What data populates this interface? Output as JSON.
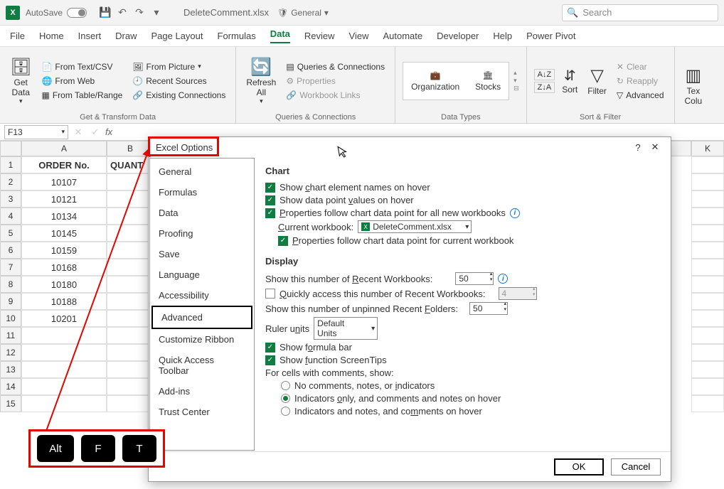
{
  "titlebar": {
    "autosave": "AutoSave",
    "filename": "DeleteComment.xlsx",
    "sensitivity": "General",
    "search_placeholder": "Search"
  },
  "menubar": {
    "items": [
      "File",
      "Home",
      "Insert",
      "Draw",
      "Page Layout",
      "Formulas",
      "Data",
      "Review",
      "View",
      "Automate",
      "Developer",
      "Help",
      "Power Pivot"
    ],
    "active": "Data"
  },
  "ribbon": {
    "getdata": {
      "big": "Get\nData",
      "items": [
        "From Text/CSV",
        "From Web",
        "From Table/Range",
        "From Picture",
        "Recent Sources",
        "Existing Connections"
      ],
      "label": "Get & Transform Data"
    },
    "refresh": {
      "big": "Refresh\nAll",
      "items": [
        "Queries & Connections",
        "Properties",
        "Workbook Links"
      ],
      "label": "Queries & Connections"
    },
    "datatypes": {
      "items": [
        "Organization",
        "Stocks"
      ],
      "label": "Data Types"
    },
    "sortfilter": {
      "sort": "Sort",
      "filter": "Filter",
      "clear": "Clear",
      "reapply": "Reapply",
      "advanced": "Advanced",
      "label": "Sort & Filter"
    },
    "text": {
      "big": "Tex\nColu"
    }
  },
  "formulabar": {
    "namebox": "F13"
  },
  "sheet": {
    "columns": [
      "A",
      "B"
    ],
    "far_col": "K",
    "headers": [
      "ORDER No.",
      "QUANT"
    ],
    "data": [
      "10107",
      "10121",
      "10134",
      "10145",
      "10159",
      "10168",
      "10180",
      "10188",
      "10201"
    ],
    "colA_width": 120,
    "colB_width": 66
  },
  "dialog": {
    "title": "Excel Options",
    "sidebar": [
      "General",
      "Formulas",
      "Data",
      "Proofing",
      "Save",
      "Language",
      "Accessibility",
      "Advanced",
      "Customize Ribbon",
      "Quick Access Toolbar",
      "Add-ins",
      "Trust Center"
    ],
    "selected": "Advanced",
    "chart": {
      "heading": "Chart",
      "o1": "Show chart element names on hover",
      "o2": "Show data point values on hover",
      "o3": "Properties follow chart data point for all new workbooks",
      "cwlabel": "Current workbook:",
      "cwvalue": "DeleteComment.xlsx",
      "o4": "Properties follow chart data point for current workbook"
    },
    "display": {
      "heading": "Display",
      "recent_label": "Show this number of Recent Workbooks:",
      "recent_value": "50",
      "quick": "Quickly access this number of Recent Workbooks:",
      "quick_value": "4",
      "folders_label": "Show this number of unpinned Recent Folders:",
      "folders_value": "50",
      "ruler_label": "Ruler units",
      "ruler_value": "Default Units",
      "fbar": "Show formula bar",
      "tips": "Show function ScreenTips",
      "comments_label": "For cells with comments, show:",
      "r1": "No comments, notes, or indicators",
      "r2": "Indicators only, and comments and notes on hover",
      "r3": "Indicators and notes, and comments on hover"
    },
    "ok": "OK",
    "cancel": "Cancel"
  },
  "keys": [
    "Alt",
    "F",
    "T"
  ]
}
